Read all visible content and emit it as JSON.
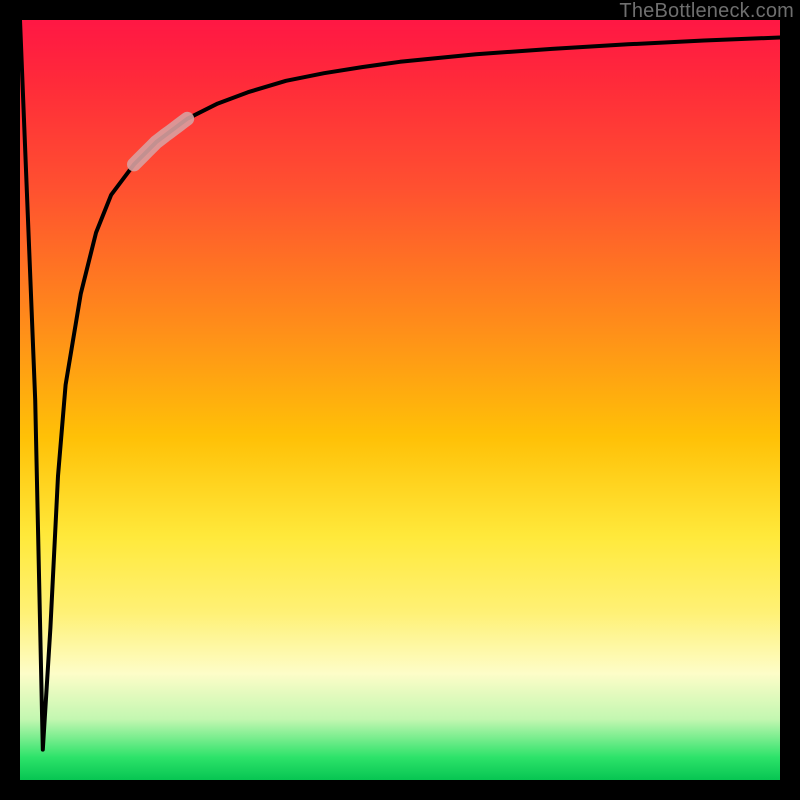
{
  "attribution": "TheBottleneck.com",
  "chart_data": {
    "type": "line",
    "title": "",
    "xlabel": "",
    "ylabel": "",
    "xlim": [
      0,
      100
    ],
    "ylim": [
      0,
      100
    ],
    "grid": false,
    "legend": false,
    "series": [
      {
        "name": "bottleneck-curve",
        "x": [
          0,
          2,
          3,
          4,
          5,
          6,
          8,
          10,
          12,
          15,
          18,
          22,
          26,
          30,
          35,
          40,
          45,
          50,
          55,
          60,
          70,
          80,
          90,
          100
        ],
        "y": [
          100,
          50,
          4,
          20,
          40,
          52,
          64,
          72,
          77,
          81,
          84,
          87,
          89,
          90.5,
          92,
          93,
          93.8,
          94.5,
          95,
          95.5,
          96.2,
          96.8,
          97.3,
          97.7
        ]
      }
    ],
    "highlight": {
      "name": "pale-segment",
      "x_start": 15,
      "x_end": 22,
      "note": "thickened pale overlay on the curve"
    }
  },
  "colors": {
    "curve": "#000000",
    "highlight": "#d8a0a0",
    "frame": "#000000"
  }
}
